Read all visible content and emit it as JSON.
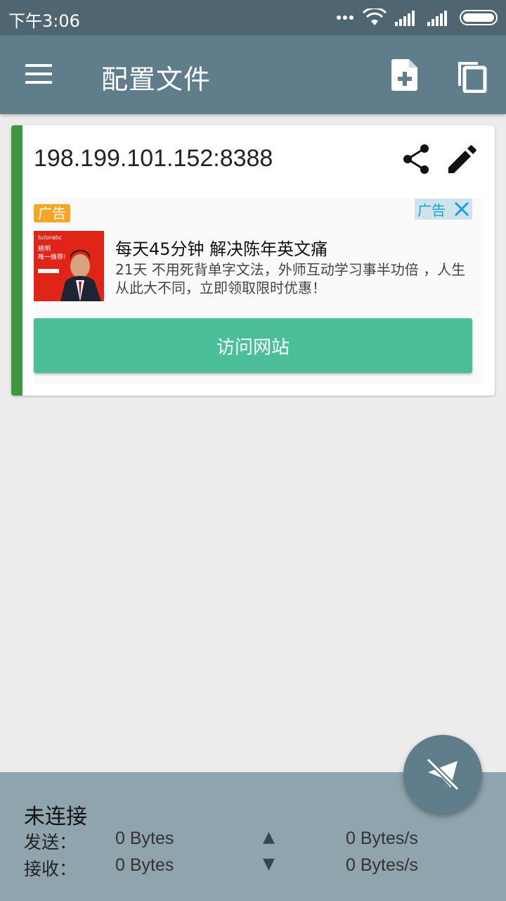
{
  "status_bar": {
    "time": "下午3:06"
  },
  "app_bar": {
    "title": "配置文件"
  },
  "profile": {
    "name": "198.199.101.152:8388"
  },
  "ad": {
    "label": "广告",
    "choice_label": "广告",
    "image_brand": "tutorabc",
    "image_text": "姚明\n唯一推荐!",
    "title": "每天45分钟 解决陈年英文痛",
    "description": "21天 不用死背单字文法，外师互动学习事半功倍 ，人生从此大不同，立即领取限时优惠！",
    "cta": "访问网站"
  },
  "bottom": {
    "status": "未连接",
    "send_label": "发送：",
    "send_bytes": "0 Bytes",
    "send_arrow": "▲",
    "send_rate": "0 Bytes/s",
    "recv_label": "接收：",
    "recv_bytes": "0 Bytes",
    "recv_arrow": "▼",
    "recv_rate": "0 Bytes/s"
  },
  "colors": {
    "status_bar": "#4f6571",
    "app_bar": "#607d8b",
    "accent": "#3e963f",
    "cta": "#4cbf9a",
    "bottom_panel": "#90a4ae"
  }
}
